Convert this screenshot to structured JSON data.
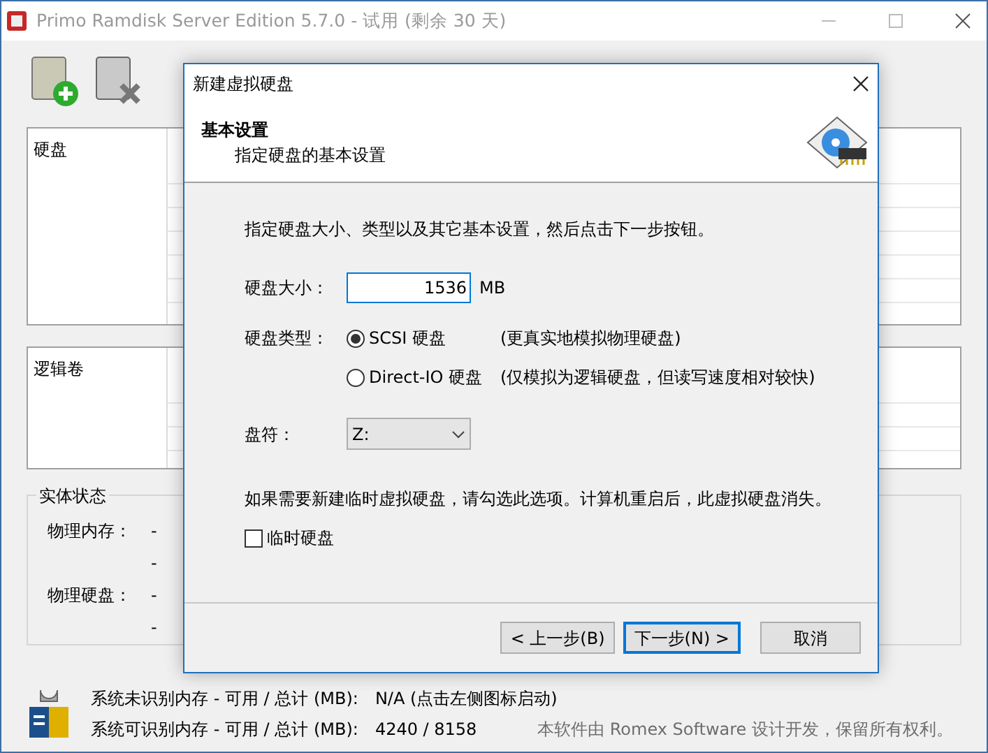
{
  "window": {
    "title": "Primo Ramdisk Server Edition 5.7.0 - 试用 (剩余 30 天)"
  },
  "disk_panel": {
    "heading": "硬盘"
  },
  "volume_panel": {
    "heading": "逻辑卷"
  },
  "physical_status": {
    "title": "实体状态",
    "rows": [
      {
        "label": "物理内存：",
        "values": [
          "-",
          "-"
        ]
      },
      {
        "label": "物理硬盘：",
        "values": [
          "-",
          "-"
        ]
      }
    ]
  },
  "footer": {
    "lines": [
      {
        "label": "系统未识别内存 - 可用 / 总计 (MB):",
        "value": "N/A (点击左侧图标启动)"
      },
      {
        "label": "系统可识别内存 - 可用 / 总计 (MB):",
        "value": "4240 / 8158"
      }
    ],
    "copyright": "本软件由 Romex Software 设计开发，保留所有权利。"
  },
  "dialog": {
    "title": "新建虚拟硬盘",
    "heading": "基本设置",
    "subheading": "指定硬盘的基本设置",
    "intro": "指定硬盘大小、类型以及其它基本设置，然后点击下一步按钮。",
    "size": {
      "label": "硬盘大小：",
      "value": "1536",
      "unit": "MB"
    },
    "type": {
      "label": "硬盘类型：",
      "options": [
        {
          "label": "SCSI 硬盘",
          "note": "(更真实地模拟物理硬盘)",
          "selected": true
        },
        {
          "label": "Direct-IO 硬盘",
          "note": "(仅模拟为逻辑硬盘，但读写速度相对较快)",
          "selected": false
        }
      ]
    },
    "drive": {
      "label": "盘符：",
      "value": "Z:"
    },
    "temp_note": "如果需要新建临时虚拟硬盘，请勾选此选项。计算机重启后，此虚拟硬盘消失。",
    "temp_checkbox": {
      "label": "临时硬盘",
      "checked": false
    },
    "buttons": [
      {
        "label": "< 上一步(B)",
        "default": false
      },
      {
        "label": "下一步(N) >",
        "default": true
      },
      {
        "label": "取消",
        "default": false
      }
    ]
  }
}
